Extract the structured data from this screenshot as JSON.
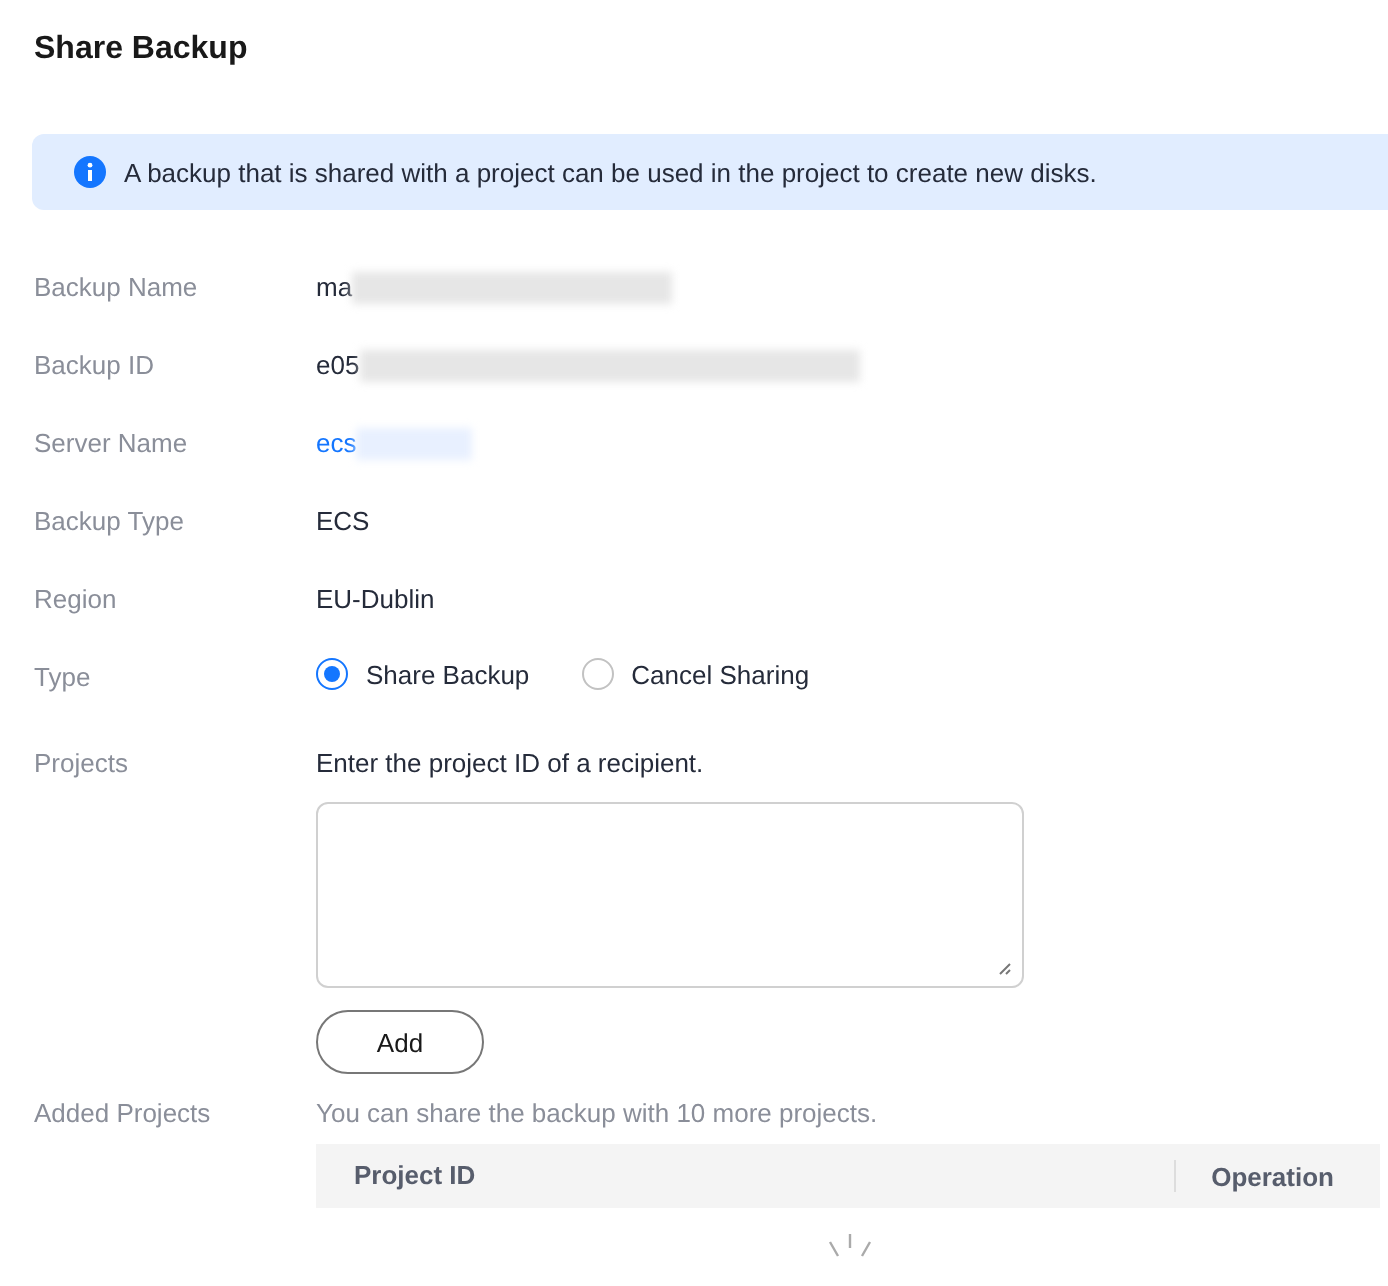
{
  "title": "Share Backup",
  "notice": "A backup that is shared with a project can be used in the project to create new disks.",
  "details": [
    {
      "label": "Backup Name",
      "value": "ma",
      "kind": "redacted"
    },
    {
      "label": "Backup ID",
      "value": "e05",
      "kind": "redacted"
    },
    {
      "label": "Server Name",
      "value": "ecs",
      "kind": "link"
    },
    {
      "label": "Backup Type",
      "value": "ECS",
      "kind": "text"
    },
    {
      "label": "Region",
      "value": "EU-Dublin",
      "kind": "text"
    }
  ],
  "type": {
    "label": "Type",
    "options": [
      {
        "label": "Share Backup",
        "selected": true
      },
      {
        "label": "Cancel Sharing",
        "selected": false
      }
    ]
  },
  "projects": {
    "label": "Projects",
    "hint": "Enter the project ID of a recipient.",
    "button": "Add"
  },
  "added_projects": {
    "label": "Added Projects",
    "note": "You can share the backup with 10 more projects.",
    "columns": [
      "Project ID",
      "Operation"
    ]
  }
}
